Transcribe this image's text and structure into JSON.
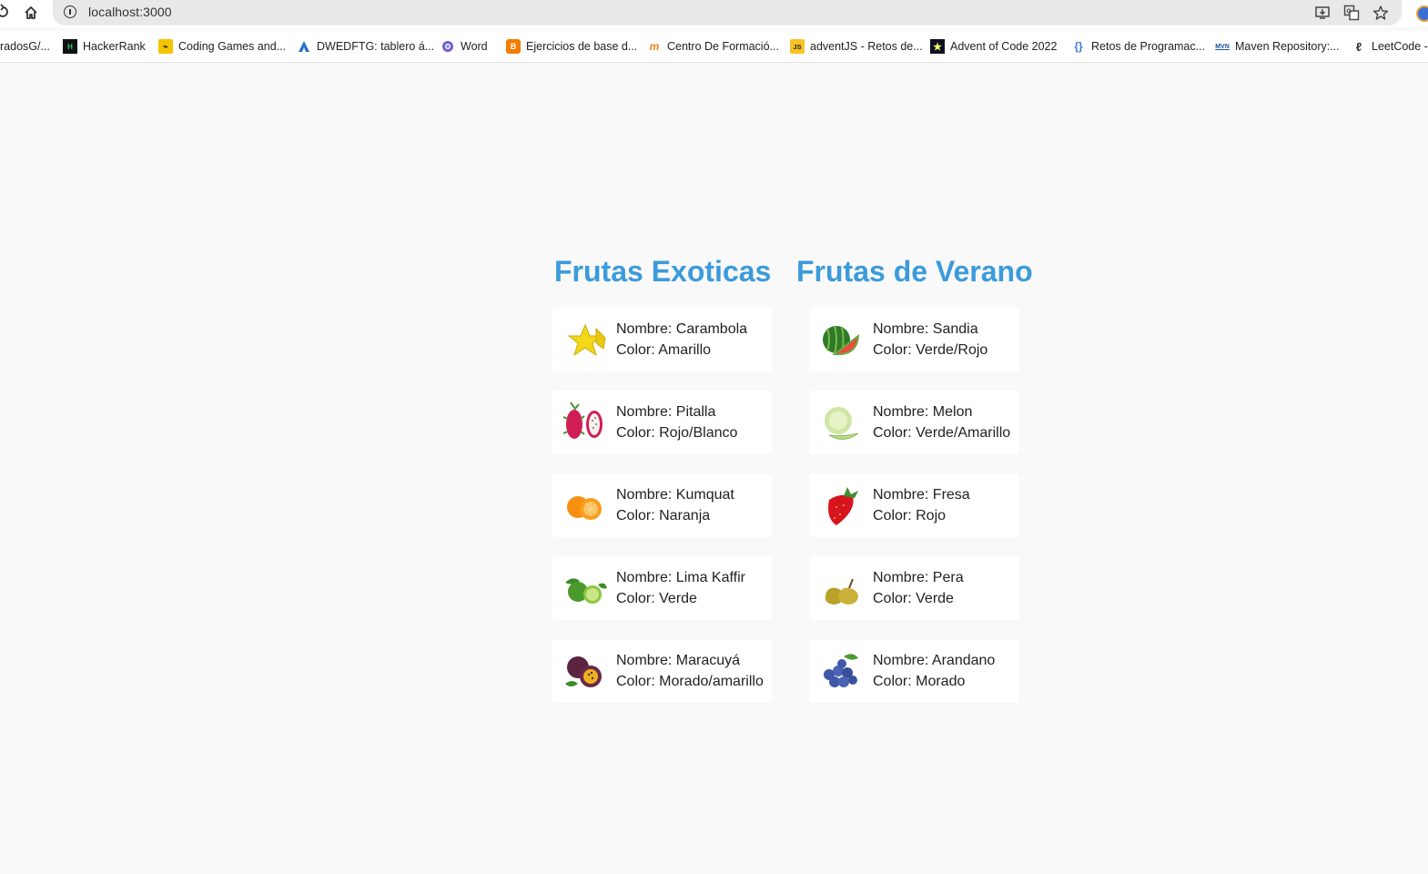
{
  "browser": {
    "url": "localhost:3000",
    "bookmarks": [
      {
        "label": "radosG/...",
        "icon": "folder-icon"
      },
      {
        "label": "HackerRank",
        "icon": "hackerrank-icon"
      },
      {
        "label": "Coding Games and...",
        "icon": "codingame-icon"
      },
      {
        "label": "DWEDFTG: tablero á...",
        "icon": "atlassian-icon"
      },
      {
        "label": "Word",
        "icon": "word-icon"
      },
      {
        "label": "Ejercicios de base d...",
        "icon": "blogger-icon"
      },
      {
        "label": "Centro De Formació...",
        "icon": "moodle-icon"
      },
      {
        "label": "adventJS - Retos de...",
        "icon": "js-icon"
      },
      {
        "label": "Advent of Code 2022",
        "icon": "star-icon"
      },
      {
        "label": "Retos de Programac...",
        "icon": "braces-icon"
      },
      {
        "label": "Maven Repository:...",
        "icon": "mvn-icon"
      },
      {
        "label": "LeetCode -",
        "icon": "leetcode-icon"
      }
    ]
  },
  "columns": [
    {
      "title": "Frutas Exoticas",
      "fruits": [
        {
          "nombre": "Nombre: Carambola",
          "color": "Color: Amarillo",
          "icon": "carambola-icon"
        },
        {
          "nombre": "Nombre: Pitalla",
          "color": "Color: Rojo/Blanco",
          "icon": "dragonfruit-icon"
        },
        {
          "nombre": "Nombre: Kumquat",
          "color": "Color: Naranja",
          "icon": "kumquat-icon"
        },
        {
          "nombre": "Nombre: Lima Kaffir",
          "color": "Color: Verde",
          "icon": "kaffir-lime-icon"
        },
        {
          "nombre": "Nombre: Maracuyá",
          "color": "Color: Morado/amarillo",
          "icon": "passionfruit-icon"
        }
      ]
    },
    {
      "title": "Frutas de Verano",
      "fruits": [
        {
          "nombre": "Nombre: Sandia",
          "color": "Color: Verde/Rojo",
          "icon": "watermelon-icon"
        },
        {
          "nombre": "Nombre: Melon",
          "color": "Color: Verde/Amarillo",
          "icon": "melon-icon"
        },
        {
          "nombre": "Nombre: Fresa",
          "color": "Color: Rojo",
          "icon": "strawberry-icon"
        },
        {
          "nombre": "Nombre: Pera",
          "color": "Color: Verde",
          "icon": "pear-icon"
        },
        {
          "nombre": "Nombre: Arandano",
          "color": "Color: Morado",
          "icon": "blueberry-icon"
        }
      ]
    }
  ],
  "colors": {
    "heading": "#3b9bdb",
    "page_bg": "#f9f9f9",
    "card_bg": "#ffffff"
  }
}
